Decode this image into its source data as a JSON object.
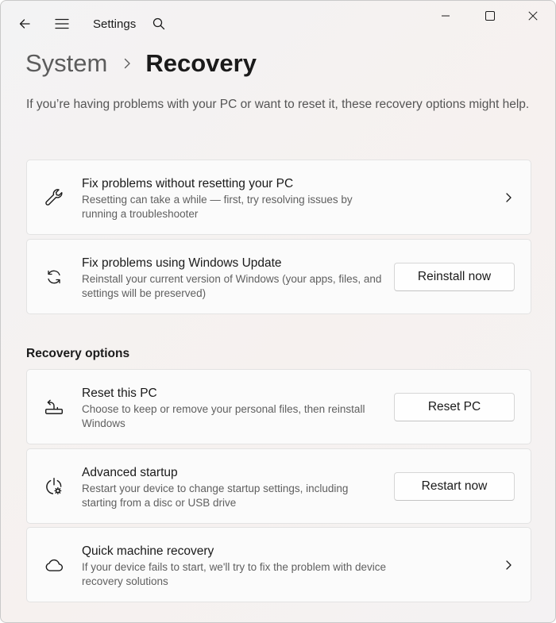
{
  "titlebar": {
    "app_title": "Settings",
    "icons": [
      "back-arrow-icon",
      "hamburger-menu-icon",
      "search-icon",
      "minimize-icon",
      "maximize-icon",
      "close-icon"
    ]
  },
  "breadcrumb": {
    "parent": "System",
    "current": "Recovery"
  },
  "intro": "If you’re having problems with your PC or want to reset it, these recovery options might help.",
  "cards_top": [
    {
      "title": "Fix problems without resetting your PC",
      "description": "Resetting can take a while — first, try resolving issues by running a troubleshooter",
      "icon": "wrench-icon",
      "action": "chevron"
    },
    {
      "title": "Fix problems using Windows Update",
      "description": "Reinstall your current version of Windows (your apps, files, and settings will be preserved)",
      "icon": "refresh-icon",
      "button": "Reinstall now"
    }
  ],
  "recovery_section": {
    "heading": "Recovery options",
    "items": [
      {
        "title": "Reset this PC",
        "description": "Choose to keep or remove your personal files, then reinstall Windows",
        "icon": "reset-pc-icon",
        "button": "Reset PC"
      },
      {
        "title": "Advanced startup",
        "description": "Restart your device to change startup settings, including starting from a disc or USB drive",
        "icon": "advanced-startup-icon",
        "button": "Restart now"
      },
      {
        "title": "Quick machine recovery",
        "description": "If your device fails to start, we'll try to fix the problem with device recovery solutions",
        "icon": "cloud-icon",
        "action": "chevron"
      }
    ]
  }
}
